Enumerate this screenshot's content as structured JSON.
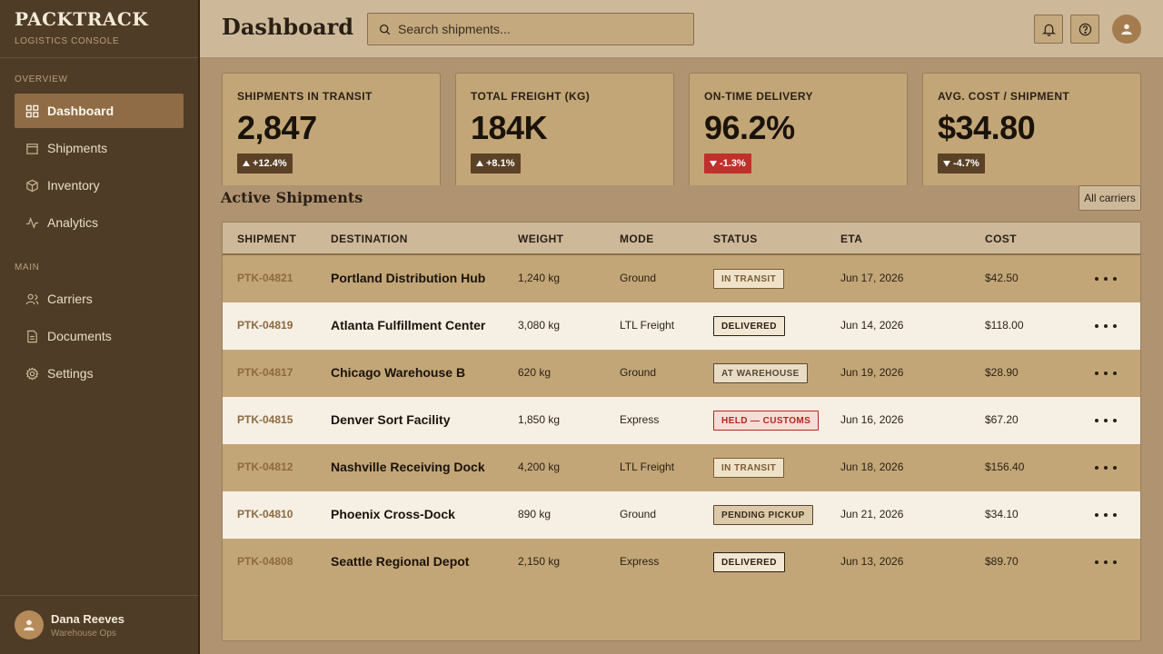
{
  "brand": {
    "name": "PACKTRACK",
    "subtitle": "LOGISTICS CONSOLE"
  },
  "sidebar": {
    "sections": [
      "OVERVIEW",
      "MAIN"
    ],
    "items": [
      {
        "label": "Dashboard",
        "icon": "grid-icon",
        "active": true
      },
      {
        "label": "Shipments",
        "icon": "box-icon"
      },
      {
        "label": "Inventory",
        "icon": "cube-icon"
      },
      {
        "label": "Analytics",
        "icon": "activity-icon"
      },
      {
        "label": "Carriers",
        "icon": "users-icon"
      },
      {
        "label": "Documents",
        "icon": "document-icon"
      },
      {
        "label": "Settings",
        "icon": "gear-icon"
      }
    ]
  },
  "user": {
    "name": "Dana Reeves",
    "role": "Warehouse Ops"
  },
  "header": {
    "title": "Dashboard",
    "search_placeholder": "Search shipments..."
  },
  "stats": [
    {
      "label": "SHIPMENTS IN TRANSIT",
      "value": "2,847",
      "change": "+12.4%",
      "direction": "up",
      "color": "#5b4126"
    },
    {
      "label": "TOTAL FREIGHT (KG)",
      "value": "184K",
      "change": "+8.1%",
      "direction": "up",
      "color": "#5b4126"
    },
    {
      "label": "ON-TIME DELIVERY",
      "value": "96.2%",
      "change": "-1.3%",
      "direction": "down",
      "color": "#c0312b"
    },
    {
      "label": "AVG. COST / SHIPMENT",
      "value": "$34.80",
      "change": "-4.7%",
      "direction": "down",
      "color": "#5b4126"
    }
  ],
  "shipments": {
    "title": "Active Shipments",
    "filter_label": "All carriers",
    "columns": [
      "SHIPMENT",
      "DESTINATION",
      "WEIGHT",
      "MODE",
      "STATUS",
      "ETA",
      "COST"
    ],
    "rows": [
      {
        "id": "PTK-04821",
        "destination": "Portland Distribution Hub",
        "weight": "1,240 kg",
        "mode": "Ground",
        "status": "IN TRANSIT",
        "eta": "Jun 17, 2026",
        "cost": "$42.50"
      },
      {
        "id": "PTK-04819",
        "destination": "Atlanta Fulfillment Center",
        "weight": "3,080 kg",
        "mode": "LTL Freight",
        "status": "DELIVERED",
        "eta": "Jun 14, 2026",
        "cost": "$118.00"
      },
      {
        "id": "PTK-04817",
        "destination": "Chicago Warehouse B",
        "weight": "620 kg",
        "mode": "Ground",
        "status": "AT WAREHOUSE",
        "eta": "Jun 19, 2026",
        "cost": "$28.90"
      },
      {
        "id": "PTK-04815",
        "destination": "Denver Sort Facility",
        "weight": "1,850 kg",
        "mode": "Express",
        "status": "HELD — CUSTOMS",
        "eta": "Jun 16, 2026",
        "cost": "$67.20"
      },
      {
        "id": "PTK-04812",
        "destination": "Nashville Receiving Dock",
        "weight": "4,200 kg",
        "mode": "LTL Freight",
        "status": "IN TRANSIT",
        "eta": "Jun 18, 2026",
        "cost": "$156.40"
      },
      {
        "id": "PTK-04810",
        "destination": "Phoenix Cross-Dock",
        "weight": "890 kg",
        "mode": "Ground",
        "status": "PENDING PICKUP",
        "eta": "Jun 21, 2026",
        "cost": "$34.10"
      },
      {
        "id": "PTK-04808",
        "destination": "Seattle Regional Depot",
        "weight": "2,150 kg",
        "mode": "Express",
        "status": "DELIVERED",
        "eta": "Jun 13, 2026",
        "cost": "$89.70"
      }
    ]
  },
  "status_colors": {
    "IN TRANSIT": {
      "bg": "#efe2c8",
      "fg": "#7a5a36",
      "border": "#7a5a36"
    },
    "DELIVERED": {
      "bg": "#f1e7d3",
      "fg": "#2a1f14",
      "border": "#2a1f14"
    },
    "AT WAREHOUSE": {
      "bg": "#e8dcc6",
      "fg": "#5b4630",
      "border": "#5b4630"
    },
    "HELD — CUSTOMS": {
      "bg": "#f6dcd6",
      "fg": "#b3261e",
      "border": "#b3261e"
    },
    "PENDING PICKUP": {
      "bg": "#dcc9a8",
      "fg": "#3a2d1e",
      "border": "#5b4630"
    }
  }
}
